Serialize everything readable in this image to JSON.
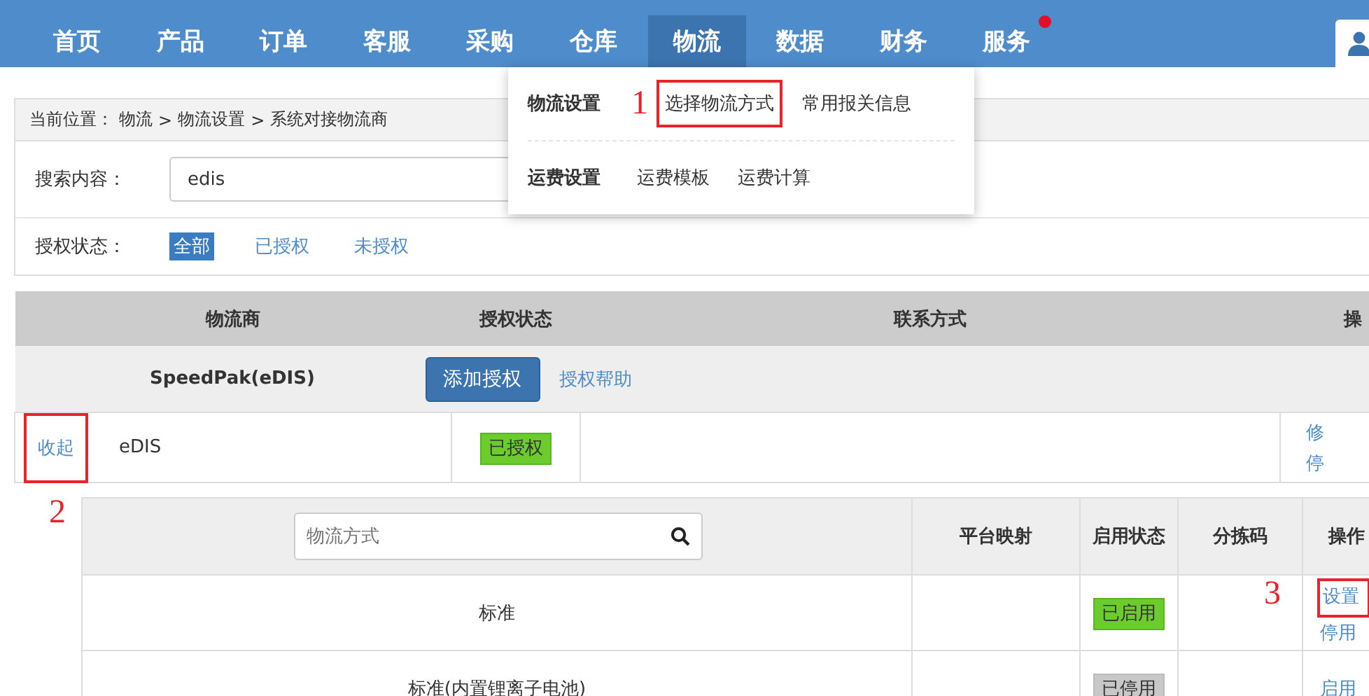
{
  "nav": {
    "items": [
      {
        "label": "首页",
        "selected": false,
        "badge": false
      },
      {
        "label": "产品",
        "selected": false,
        "badge": false
      },
      {
        "label": "订单",
        "selected": false,
        "badge": false
      },
      {
        "label": "客服",
        "selected": false,
        "badge": false
      },
      {
        "label": "采购",
        "selected": false,
        "badge": false
      },
      {
        "label": "仓库",
        "selected": false,
        "badge": false
      },
      {
        "label": "物流",
        "selected": true,
        "badge": false
      },
      {
        "label": "数据",
        "selected": false,
        "badge": false
      },
      {
        "label": "财务",
        "selected": false,
        "badge": false
      },
      {
        "label": "服务",
        "selected": false,
        "badge": true
      }
    ]
  },
  "dropdown": {
    "groups": [
      {
        "title": "物流设置",
        "links": [
          {
            "label": "选择物流方式",
            "highlighted": true,
            "number": "1"
          },
          {
            "label": "常用报关信息",
            "highlighted": false
          }
        ]
      },
      {
        "title": "运费设置",
        "links": [
          {
            "label": "运费模板",
            "highlighted": false
          },
          {
            "label": "运费计算",
            "highlighted": false
          }
        ]
      }
    ]
  },
  "breadcrumb": {
    "label": "当前位置：",
    "separator": ">",
    "crumbs": [
      "物流",
      "物流设置",
      "系统对接物流商"
    ]
  },
  "search": {
    "label": "搜索内容：",
    "value": "edis"
  },
  "filter": {
    "label": "授权状态：",
    "options": [
      {
        "label": "全部",
        "selected": true
      },
      {
        "label": "已授权",
        "selected": false
      },
      {
        "label": "未授权",
        "selected": false
      }
    ]
  },
  "table": {
    "columns": [
      "物流商",
      "授权状态",
      "联系方式",
      "操"
    ],
    "group": {
      "name": "SpeedPak(eDIS)",
      "button": "添加授权",
      "help": "授权帮助"
    },
    "row": {
      "toggle": {
        "label": "收起",
        "highlighted": true,
        "number": "2"
      },
      "name": "eDIS",
      "status": {
        "label": "已授权",
        "authorized": true
      },
      "actions": [
        "修",
        "停"
      ]
    }
  },
  "methods": {
    "placeholder": "物流方式",
    "columns": [
      "平台映射",
      "启用状态",
      "分拣码",
      "操作"
    ],
    "rows": [
      {
        "name": "标准",
        "status": {
          "label": "已启用",
          "enabled": true
        },
        "actions": [
          {
            "label": "设置",
            "highlighted": true,
            "number": "3"
          },
          {
            "label": "停用",
            "highlighted": false
          }
        ]
      },
      {
        "name": "标准(内置锂离子电池)",
        "status": {
          "label": "已停用",
          "enabled": false
        },
        "actions": [
          {
            "label": "启用",
            "highlighted": false
          }
        ]
      }
    ]
  }
}
